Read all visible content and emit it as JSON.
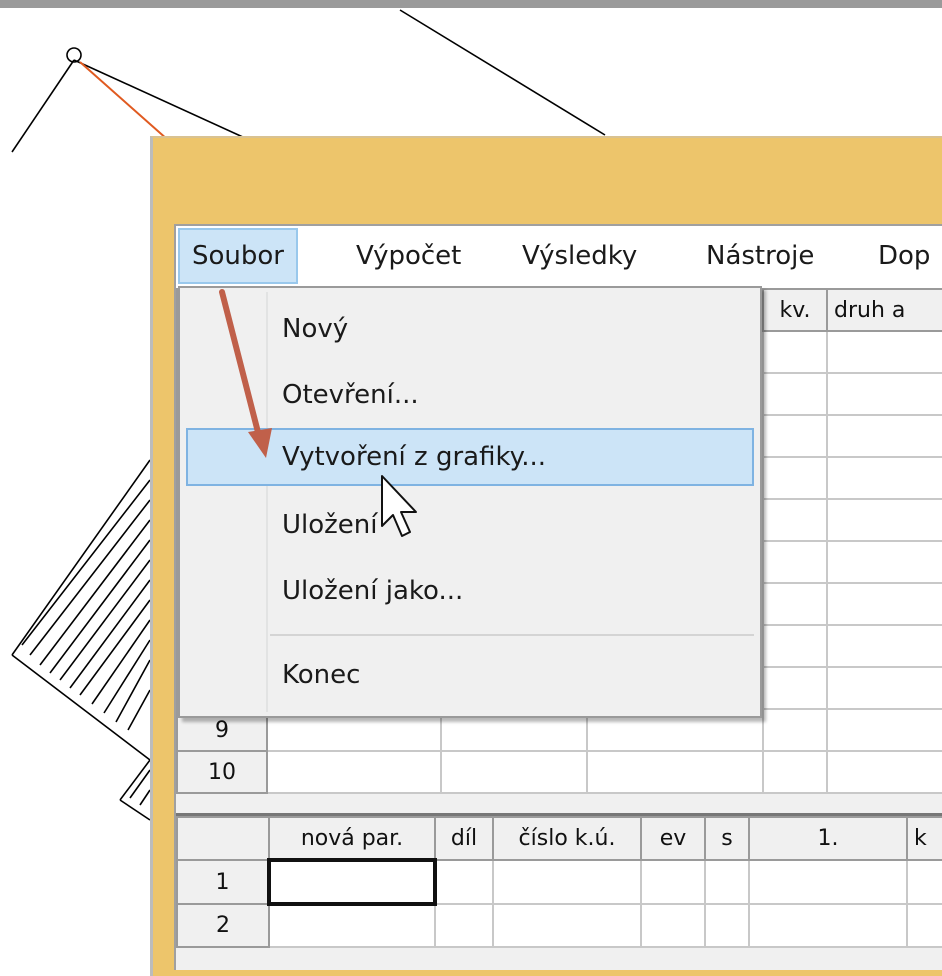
{
  "menubar": {
    "items": [
      {
        "label": "Soubor",
        "active": true
      },
      {
        "label": "Výpočet"
      },
      {
        "label": "Výsledky"
      },
      {
        "label": "Nástroje"
      },
      {
        "label": "Dop"
      }
    ]
  },
  "dropdown": {
    "items": [
      {
        "label": "Nový"
      },
      {
        "label": "Otevření..."
      },
      {
        "label": "Vytvoření z grafiky...",
        "highlighted": true
      },
      {
        "label": "Uložení"
      },
      {
        "label": "Uložení jako..."
      },
      {
        "label": "Konec"
      }
    ]
  },
  "upper_grid": {
    "headers_visible": [
      "kv.",
      "druh a"
    ],
    "rows": [
      "9",
      "10"
    ]
  },
  "lower_grid": {
    "headers": [
      "nová par.",
      "díl",
      "číslo k.ú.",
      "ev",
      "s",
      "1.",
      "k"
    ],
    "rows": [
      "1",
      "2"
    ]
  },
  "colors": {
    "window_frame": "#edc56b",
    "highlight": "#cce4f7",
    "arrow": "#c0604a"
  },
  "icons": [
    "mouse-pointer-icon",
    "annotation-arrow-icon"
  ]
}
